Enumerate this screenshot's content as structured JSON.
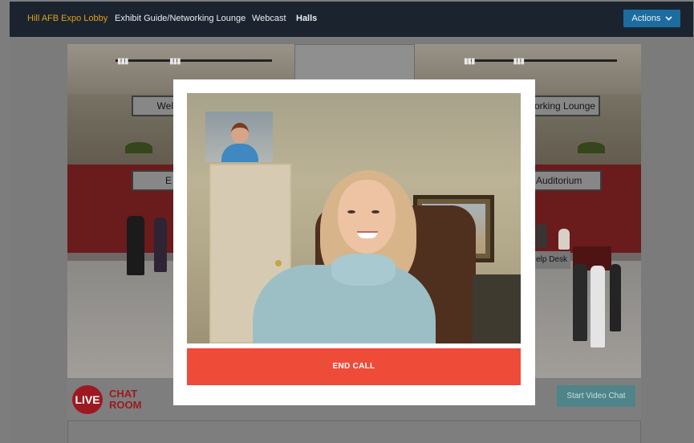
{
  "nav": {
    "items": [
      {
        "label": "Hill AFB Expo Lobby",
        "active": true
      },
      {
        "label": "Exhibit Guide/Networking Lounge",
        "active": false
      },
      {
        "label": "Webcast",
        "active": false
      },
      {
        "label": "Halls",
        "active": false
      }
    ],
    "actions_label": "Actions",
    "actions_icon": "chevron-down-icon"
  },
  "lobby": {
    "signs": {
      "left_top": "Wel",
      "right_top": "orking Lounge",
      "left_mid": "E",
      "right_mid": "Auditorium",
      "help_desk": "elp Desk"
    },
    "live_chat": {
      "live": "LIVE",
      "chat": "CHAT",
      "room": "ROOM"
    },
    "start_video_chat": "Start Video Chat"
  },
  "modal": {
    "end_call_label": "END CALL"
  },
  "colors": {
    "nav_bg": "#1b232e",
    "nav_active": "#d9a21f",
    "actions_btn": "#1c6c9f",
    "end_call": "#ee4b39",
    "start_video": "#4f8489",
    "live_red": "#9d1922"
  }
}
